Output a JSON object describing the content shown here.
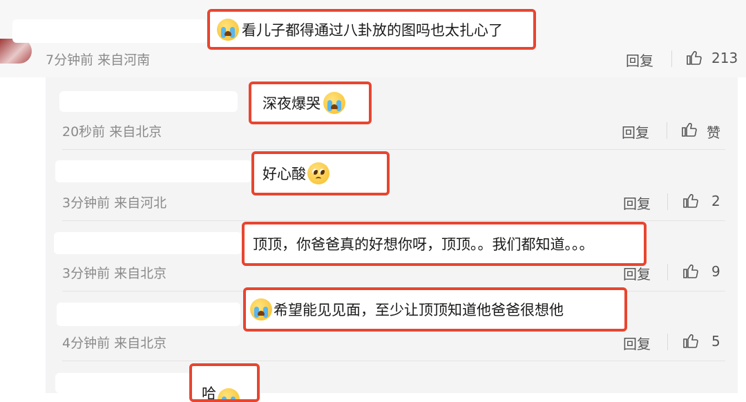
{
  "main_comment": {
    "text": "看儿子都得通过八卦放的图吗也太扎心了",
    "meta": "7分钟前  来自河南",
    "reply_label": "回复",
    "likes": "213"
  },
  "replies": [
    {
      "text": "深夜爆哭",
      "meta": "20秒前  来自北京",
      "reply_label": "回复",
      "likes": "赞"
    },
    {
      "text": "好心酸",
      "meta": "3分钟前  来自河北",
      "reply_label": "回复",
      "likes": "2"
    },
    {
      "text": "顶顶，你爸爸真的好想你呀，顶顶。。我们都知道。。。",
      "meta": "3分钟前  来自北京",
      "reply_label": "回复",
      "likes": "9"
    },
    {
      "text": "希望能见见面，至少让顶顶知道他爸爸很想他",
      "meta": "4分钟前  来自北京",
      "reply_label": "回复",
      "likes": "5"
    },
    {
      "text": "哈"
    }
  ],
  "icons": {
    "thumb": "thumbs-up-icon",
    "crying": "crying-face-icon",
    "pleading": "pleading-face-icon"
  },
  "colors": {
    "highlight": "#e8452f",
    "meta": "#8a8a8a"
  }
}
